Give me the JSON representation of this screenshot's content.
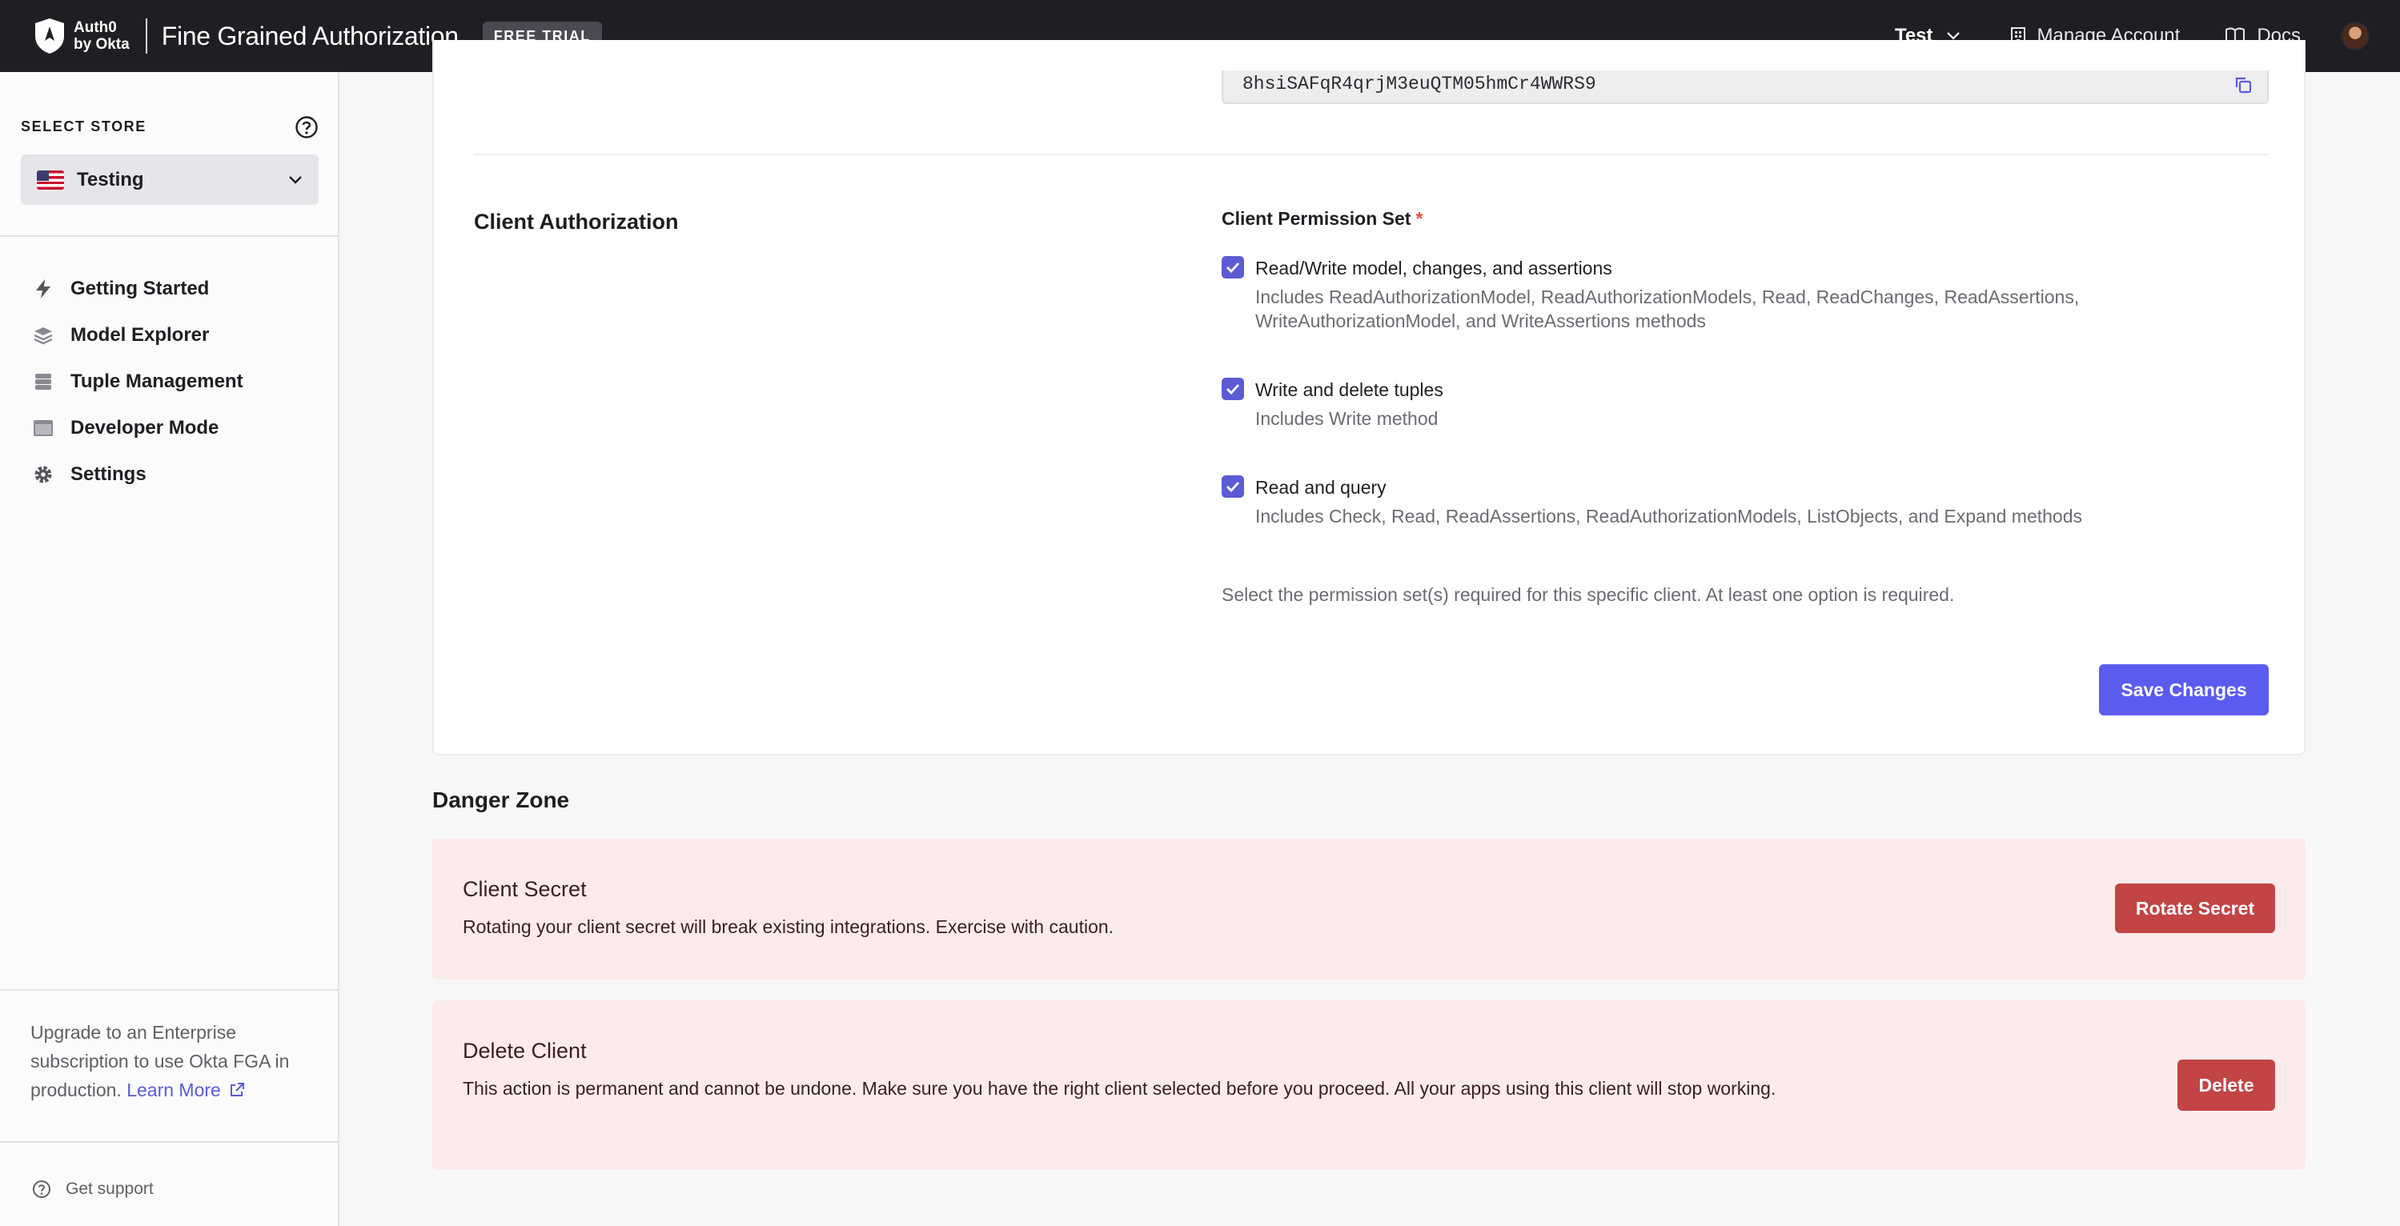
{
  "header": {
    "logo_line1": "Auth0",
    "logo_line2": "by Okta",
    "product_name": "Fine Grained Authorization",
    "badge": "FREE TRIAL",
    "tenant": "Test",
    "manage_account": "Manage Account",
    "docs": "Docs"
  },
  "sidebar": {
    "store_label": "SELECT STORE",
    "store_name": "Testing",
    "items": [
      {
        "label": "Getting Started",
        "icon": "bolt-icon"
      },
      {
        "label": "Model Explorer",
        "icon": "layers-icon"
      },
      {
        "label": "Tuple Management",
        "icon": "database-icon"
      },
      {
        "label": "Developer Mode",
        "icon": "terminal-icon"
      },
      {
        "label": "Settings",
        "icon": "gear-icon"
      }
    ],
    "upgrade_text": "Upgrade to an Enterprise subscription to use Okta FGA in production.",
    "learn_more": "Learn More",
    "support": "Get support"
  },
  "client": {
    "secret_value": "8hsiSAFqR4qrjM3euQTM05hmCr4WWRS9",
    "section_title": "Client Authorization",
    "permission_label": "Client Permission Set",
    "required_mark": "*",
    "permissions": [
      {
        "title": "Read/Write model, changes, and assertions",
        "desc": "Includes ReadAuthorizationModel, ReadAuthorizationModels, Read, ReadChanges, ReadAssertions, WriteAuthorizationModel, and WriteAssertions methods",
        "checked": true
      },
      {
        "title": "Write and delete tuples",
        "desc": "Includes Write method",
        "checked": true
      },
      {
        "title": "Read and query",
        "desc": "Includes Check, Read, ReadAssertions, ReadAuthorizationModels, ListObjects, and Expand methods",
        "checked": true
      }
    ],
    "help_text": "Select the permission set(s) required for this specific client. At least one option is required.",
    "save_label": "Save Changes"
  },
  "danger": {
    "title": "Danger Zone",
    "secret_title": "Client Secret",
    "secret_desc": "Rotating your client secret will break existing integrations. Exercise with caution.",
    "rotate_label": "Rotate Secret",
    "delete_title": "Delete Client",
    "delete_desc": "This action is permanent and cannot be undone. Make sure you have the right client selected before you proceed. All your apps using this client will stop working.",
    "delete_label": "Delete"
  },
  "colors": {
    "topbar": "#1f1f23",
    "accent": "#5b5bf0",
    "danger_button": "#c24444",
    "danger_bg": "#fcebeb"
  }
}
